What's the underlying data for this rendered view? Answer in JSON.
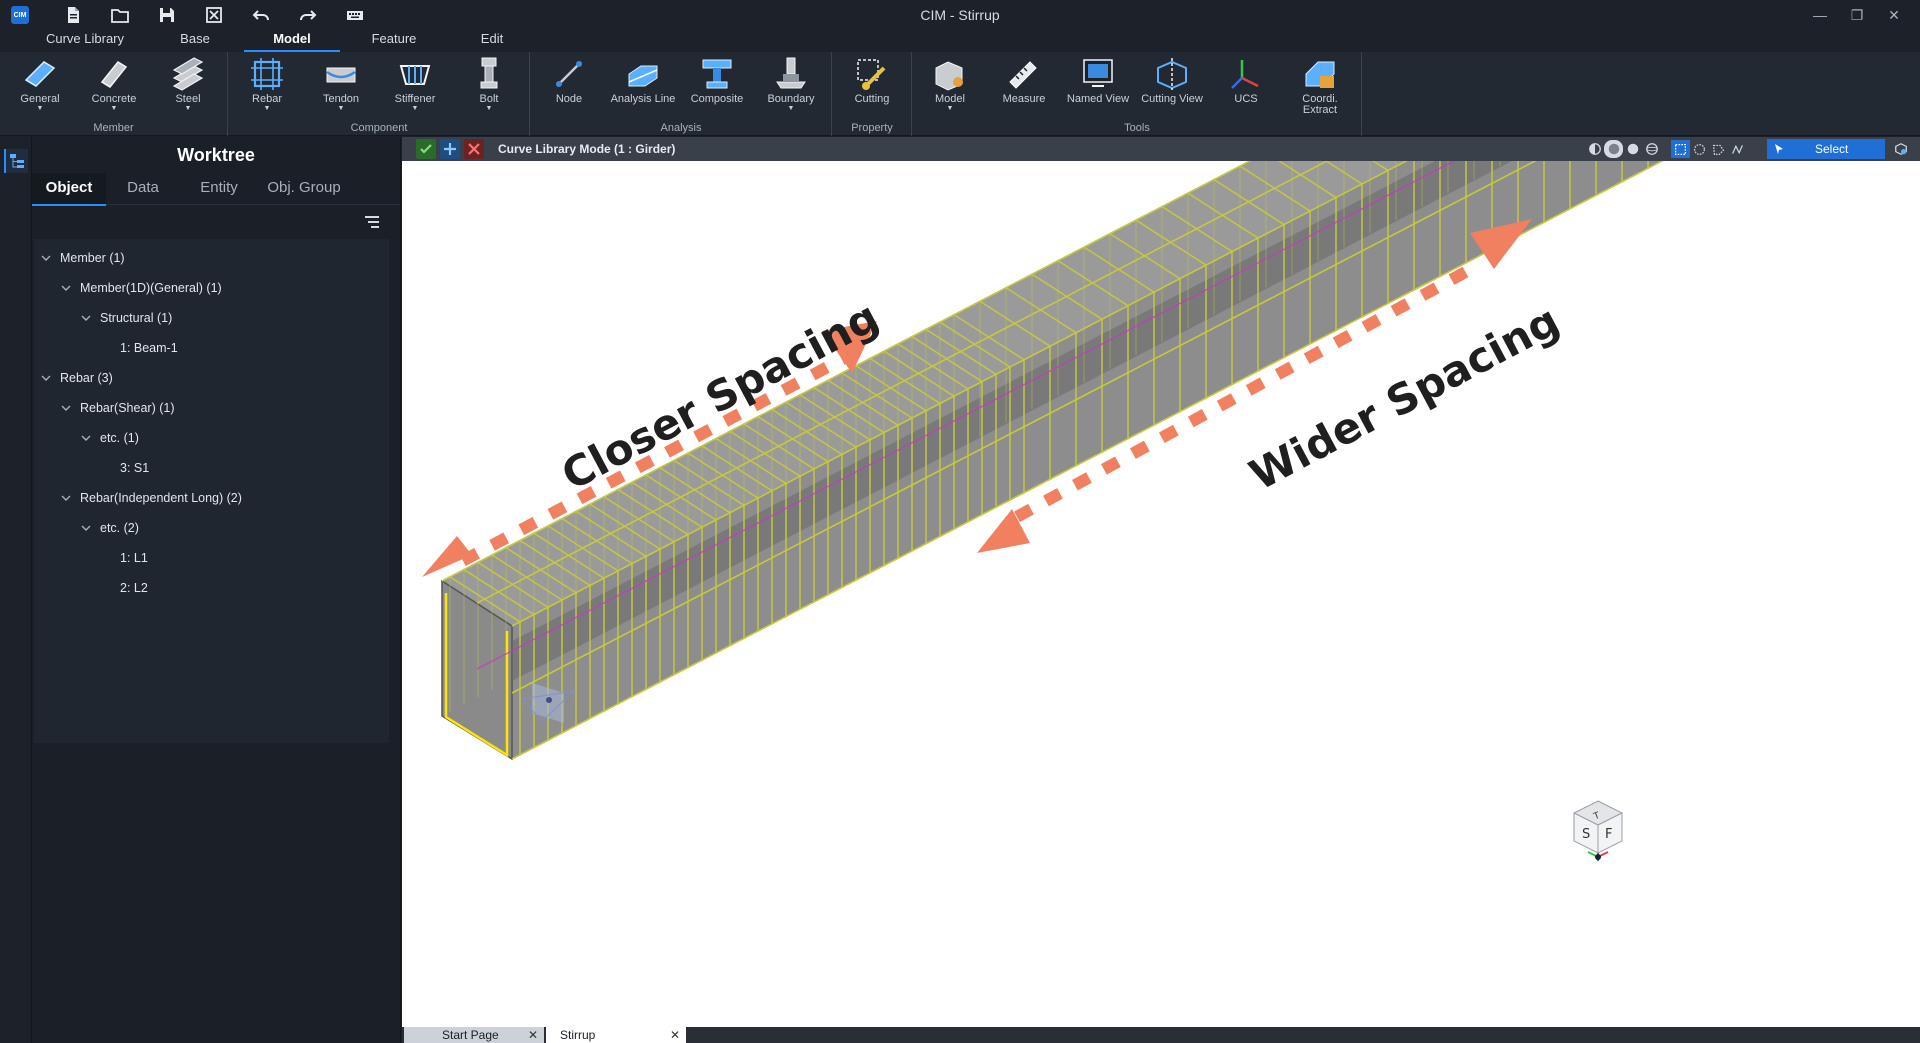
{
  "window": {
    "title": "CIM - Stirrup",
    "logo_text": "CIM",
    "quick_access": [
      "new-file-icon",
      "open-folder-icon",
      "save-icon",
      "close-file-icon",
      "undo-icon",
      "redo-icon",
      "keyboard-icon"
    ]
  },
  "menu": {
    "tabs": [
      {
        "label": "Curve Library",
        "active": false
      },
      {
        "label": "Base",
        "active": false
      },
      {
        "label": "Model",
        "active": true
      },
      {
        "label": "Feature",
        "active": false
      },
      {
        "label": "Edit",
        "active": false
      }
    ]
  },
  "ribbon": {
    "groups": [
      {
        "label": "Member",
        "buttons": [
          {
            "label": "General",
            "icon": "general-member-icon",
            "has_dropdown": true
          },
          {
            "label": "Concrete",
            "icon": "concrete-member-icon",
            "has_dropdown": true
          },
          {
            "label": "Steel",
            "icon": "steel-member-icon",
            "has_dropdown": true
          }
        ]
      },
      {
        "label": "Component",
        "buttons": [
          {
            "label": "Rebar",
            "icon": "rebar-icon",
            "has_dropdown": true
          },
          {
            "label": "Tendon",
            "icon": "tendon-icon",
            "has_dropdown": true
          },
          {
            "label": "Stiffener",
            "icon": "stiffener-icon",
            "has_dropdown": true
          },
          {
            "label": "Bolt",
            "icon": "bolt-icon",
            "has_dropdown": true
          }
        ]
      },
      {
        "label": "Analysis",
        "buttons": [
          {
            "label": "Node",
            "icon": "node-icon",
            "has_dropdown": false
          },
          {
            "label": "Analysis Line",
            "icon": "analysis-line-icon",
            "has_dropdown": false
          },
          {
            "label": "Composite",
            "icon": "composite-icon",
            "has_dropdown": false
          },
          {
            "label": "Boundary",
            "icon": "boundary-icon",
            "has_dropdown": true
          }
        ]
      },
      {
        "label": "Property",
        "buttons": [
          {
            "label": "Cutting",
            "icon": "cutting-icon",
            "has_dropdown": false
          }
        ]
      },
      {
        "label": "Tools",
        "buttons": [
          {
            "label": "Model",
            "icon": "model-tool-icon",
            "has_dropdown": true
          },
          {
            "label": "Measure",
            "icon": "measure-icon",
            "has_dropdown": false
          },
          {
            "label": "Named View",
            "icon": "named-view-icon",
            "has_dropdown": false
          },
          {
            "label": "Cutting View",
            "icon": "cutting-view-icon",
            "has_dropdown": false
          },
          {
            "label": "UCS",
            "icon": "ucs-icon",
            "has_dropdown": false
          },
          {
            "label": "Coordi.\nExtract",
            "icon": "coordinate-extract-icon",
            "has_dropdown": false
          }
        ]
      }
    ]
  },
  "worktree": {
    "title": "Worktree",
    "tabs": [
      {
        "label": "Object",
        "active": true
      },
      {
        "label": "Data",
        "active": false
      },
      {
        "label": "Entity",
        "active": false
      },
      {
        "label": "Obj. Group",
        "active": false
      }
    ],
    "tree": [
      {
        "label": "Member (1)",
        "level": 0,
        "expanded": true
      },
      {
        "label": "Member(1D)(General) (1)",
        "level": 1,
        "expanded": true
      },
      {
        "label": "Structural (1)",
        "level": 2,
        "expanded": true
      },
      {
        "label": "1: Beam-1",
        "level": 3,
        "expanded": null
      },
      {
        "label": "Rebar (3)",
        "level": 0,
        "expanded": true
      },
      {
        "label": "Rebar(Shear) (1)",
        "level": 1,
        "expanded": true
      },
      {
        "label": "etc. (1)",
        "level": 2,
        "expanded": true
      },
      {
        "label": "3: S1",
        "level": 3,
        "expanded": null
      },
      {
        "label": "Rebar(Independent Long) (2)",
        "level": 1,
        "expanded": true
      },
      {
        "label": "etc. (2)",
        "level": 2,
        "expanded": true
      },
      {
        "label": "1: L1",
        "level": 3,
        "expanded": null
      },
      {
        "label": "2: L2",
        "level": 3,
        "expanded": null
      }
    ]
  },
  "viewport": {
    "mode_label": "Curve Library Mode (1 : Girder)",
    "select_label": "Select",
    "annotations": {
      "left": "Closer Spacing",
      "right": "Wider Spacing"
    },
    "view_cube": {
      "left_face": "S",
      "right_face": "F",
      "top_face": "T"
    },
    "colors": {
      "concrete": "#8a8a8a",
      "rebar": "#c8c840",
      "centerline": "#c03cc0",
      "arrow": "#f08060",
      "accent": "#2b8cff"
    }
  },
  "doc_tabs": [
    {
      "label": "Start Page",
      "active": false
    },
    {
      "label": "Stirrup",
      "active": true
    }
  ]
}
